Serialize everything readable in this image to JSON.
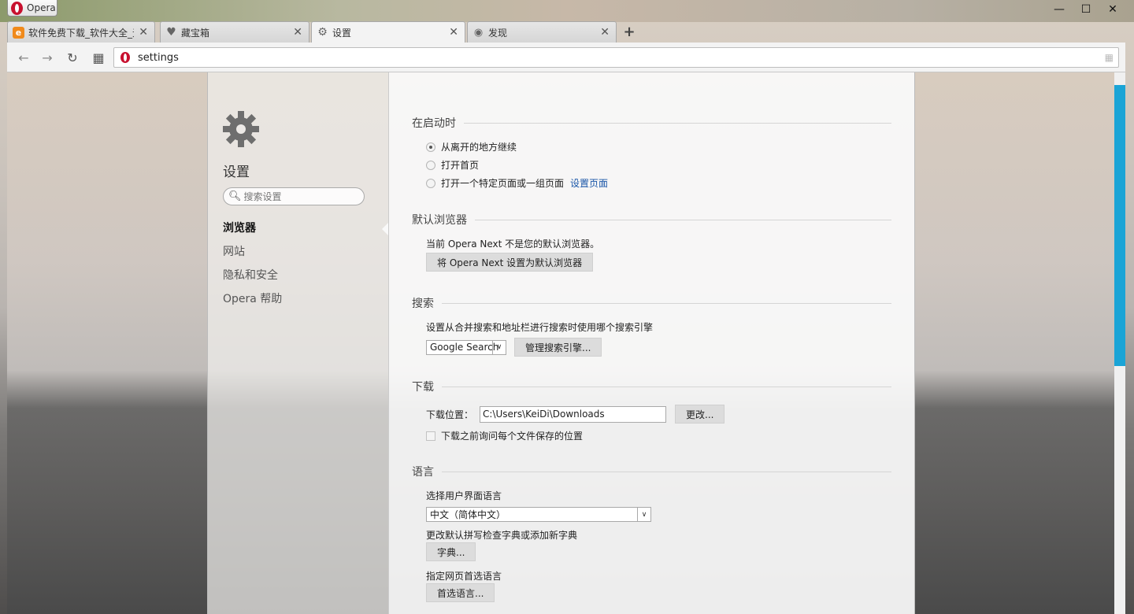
{
  "window": {
    "app_button_label": "Opera",
    "controls": {
      "minimize": "—",
      "maximize": "☐",
      "close": "✕"
    }
  },
  "tabs": [
    {
      "label": "软件免费下载_软件大全_无",
      "icon": "orange-e-icon",
      "active": false
    },
    {
      "label": "藏宝箱",
      "icon": "heart-icon",
      "active": false
    },
    {
      "label": "设置",
      "icon": "gear-icon",
      "active": true
    },
    {
      "label": "发现",
      "icon": "eye-icon",
      "active": false
    }
  ],
  "toolbar": {
    "back": "←",
    "forward": "→",
    "reload": "↻",
    "speed_dial": "▦",
    "address": "settings"
  },
  "sidebar": {
    "title": "设置",
    "search_placeholder": "搜索设置",
    "items": [
      {
        "label": "浏览器",
        "active": true
      },
      {
        "label": "网站",
        "active": false
      },
      {
        "label": "隐私和安全",
        "active": false
      },
      {
        "label": "Opera 帮助",
        "active": false
      }
    ]
  },
  "startup": {
    "title": "在启动时",
    "options": [
      {
        "label": "从离开的地方继续",
        "checked": true
      },
      {
        "label": "打开首页",
        "checked": false
      },
      {
        "label": "打开一个特定页面或一组页面",
        "checked": false
      }
    ],
    "set_pages_link": "设置页面"
  },
  "default_browser": {
    "title": "默认浏览器",
    "status": "当前 Opera Next 不是您的默认浏览器。",
    "button": "将 Opera Next 设置为默认浏览器"
  },
  "search": {
    "title": "搜索",
    "description": "设置从合并搜索和地址栏进行搜索时使用哪个搜索引擎",
    "engine": "Google Search",
    "manage_button": "管理搜索引擎..."
  },
  "downloads": {
    "title": "下载",
    "location_label": "下载位置：",
    "location_value": "C:\\Users\\KeiDi\\Downloads",
    "change_button": "更改...",
    "ask_label": "下载之前询问每个文件保存的位置"
  },
  "language": {
    "title": "语言",
    "ui_label": "选择用户界面语言",
    "ui_value": "中文（简体中文）",
    "spell_label": "更改默认拼写检查字典或添加新字典",
    "dict_button": "字典...",
    "pref_label": "指定网页首选语言",
    "pref_button": "首选语言..."
  },
  "colors": {
    "accent": "#1aa4d6",
    "link": "#1a56a8",
    "opera_red": "#c8102e"
  }
}
